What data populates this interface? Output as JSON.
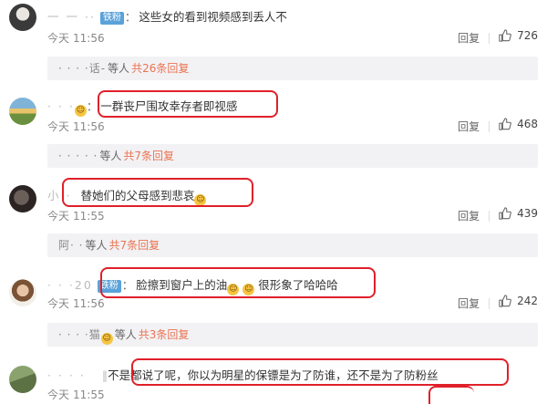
{
  "comments": [
    {
      "name": "一 一 ··",
      "badge": "铁粉",
      "separator": "：",
      "text": "这些女的看到视频感到丢人不",
      "date": "今天",
      "time": "11:56",
      "reply_label": "回复",
      "likes": "726",
      "replies_bar": {
        "names": "· · · ·话-",
        "etc": "等人",
        "link": "共26条回复"
      }
    },
    {
      "name": "· · ·",
      "separator": "：",
      "text": "一群丧尸围攻幸存者即视感",
      "date": "今天",
      "time": "11:56",
      "reply_label": "回复",
      "likes": "468",
      "replies_bar": {
        "names": "· · · · ·",
        "etc": "等人",
        "link": "共7条回复"
      }
    },
    {
      "name": "小 ·",
      "separator": "",
      "text": "替她们的父母感到悲哀",
      "date": "今天",
      "time": "11:55",
      "reply_label": "回复",
      "likes": "439",
      "replies_bar": {
        "names": "阿· ·",
        "etc": "等人",
        "link": "共7条回复"
      }
    },
    {
      "name": "· · ·20",
      "badge": "铁粉",
      "separator": "：",
      "text": "脸擦到窗户上的油",
      "text2": "很形象了哈哈哈",
      "date": "今天",
      "time": "11:56",
      "reply_label": "回复",
      "likes": "242",
      "replies_bar": {
        "names": "· · · ·猫",
        "etc": "等人",
        "link": "共3条回复"
      }
    },
    {
      "name": "· · · ·",
      "separator": "",
      "text": "不是都说了呢，你以为明星的保镖是为了防谁，还不是为了防粉丝",
      "date": "今天",
      "time": "11:55"
    }
  ],
  "colors": {
    "highlight": "#e0202a",
    "link": "#eb7350",
    "badge": "#5aa2d9"
  },
  "icons": {
    "like": "thumbs-up-icon",
    "emoji": "emoji-icon"
  }
}
